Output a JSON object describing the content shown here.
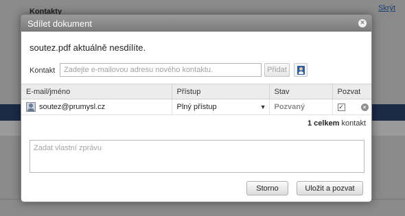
{
  "background": {
    "title": "Kontakty",
    "hide_link": "Skrýt"
  },
  "dialog": {
    "title": "Sdílet dokument",
    "close_icon": "close-icon",
    "status_message": "soutez.pdf aktuálně nesdílíte.",
    "contact": {
      "label": "Kontakt",
      "placeholder": "Zadejte e-mailovou adresu nového kontaktu.",
      "value": "",
      "add_label": "Přidat",
      "address_book_icon": "address-book-icon"
    },
    "table": {
      "headers": [
        "E-mail/jméno",
        "Přístup",
        "Stav",
        "Pozvat"
      ],
      "rows": [
        {
          "email": "soutez@prumysl.cz",
          "access": "Plný přístup",
          "state": "Pozvaný",
          "invite_checked": true
        }
      ]
    },
    "total": {
      "count": "1 celkem",
      "unit": "kontakt"
    },
    "message": {
      "placeholder": "Zadat vlastní zprávu",
      "value": ""
    },
    "buttons": {
      "cancel": "Storno",
      "submit": "Uložit a pozvat"
    }
  }
}
